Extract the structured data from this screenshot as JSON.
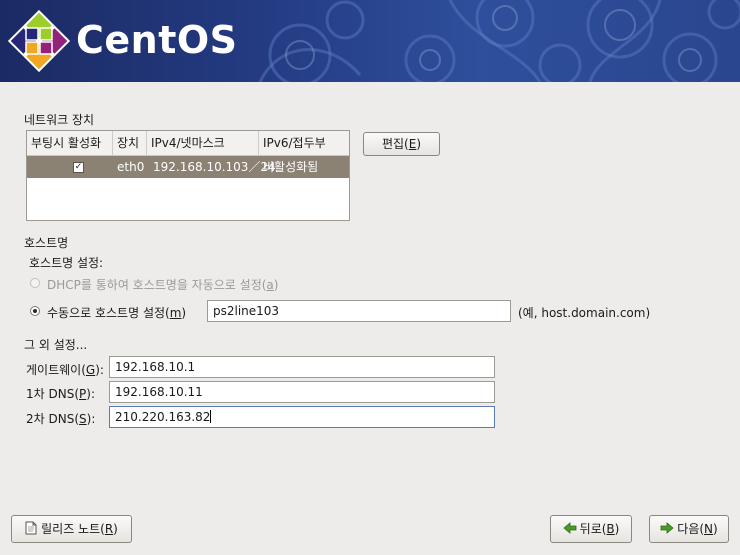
{
  "header": {
    "brand": "CentOS"
  },
  "devices": {
    "section_title": "네트워크 장치",
    "columns": [
      "부팅시 활성화",
      "장치",
      "IPv4/넷마스크",
      "IPv6/접두부"
    ],
    "rows": [
      {
        "active_on_boot": true,
        "device": "eth0",
        "ipv4": "192.168.10.103／24",
        "ipv6": "비활성화됨"
      }
    ],
    "edit_button": {
      "pre": "편집(",
      "key": "E",
      "post": ")"
    }
  },
  "hostname": {
    "section_title": "호스트명",
    "settings_label": "호스트명 설정:",
    "dhcp_option": {
      "pre": "DHCP를 통하여 호스트명을 자동으로 설정(",
      "key": "a",
      "post": ")",
      "selected": false,
      "enabled": false
    },
    "manual_option": {
      "pre": "수동으로 호스트명 설정(",
      "key": "m",
      "post": ")",
      "selected": true
    },
    "value": "ps2line103",
    "example": "(예, host.domain.com)"
  },
  "other": {
    "section_title": "그 외 설정...",
    "gateway": {
      "label_pre": "게이트웨이(",
      "key": "G",
      "label_post": "):",
      "value": "192.168.10.1"
    },
    "dns1": {
      "label_pre": "1차 DNS(",
      "key": "P",
      "label_post": "):",
      "value": "192.168.10.11"
    },
    "dns2": {
      "label_pre": "2차 DNS(",
      "key": "S",
      "label_post": "):",
      "value": "210.220.163.82"
    }
  },
  "footer": {
    "release_notes": {
      "pre": "릴리즈 노트(",
      "key": "R",
      "post": ")"
    },
    "back": {
      "pre": "뒤로(",
      "key": "B",
      "post": ")"
    },
    "next": {
      "pre": "다음(",
      "key": "N",
      "post": ")"
    }
  }
}
